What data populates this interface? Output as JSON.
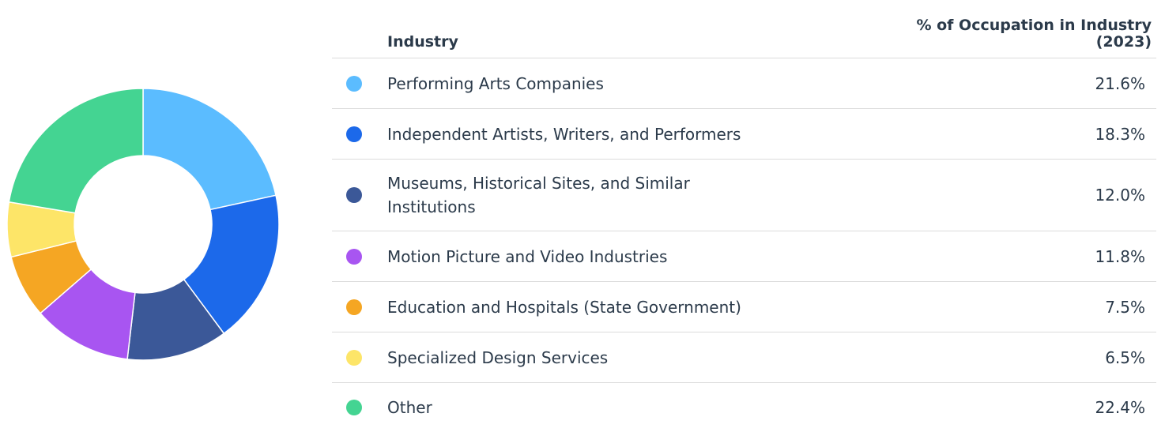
{
  "table": {
    "header_industry": "Industry",
    "header_pct_line1": "% of Occupation in Industry",
    "header_pct_line2": "(2023)"
  },
  "chart_data": {
    "type": "pie",
    "categories": [
      "Performing Arts Companies",
      "Independent Artists, Writers, and Performers",
      "Museums, Historical Sites, and Similar Institutions",
      "Motion Picture and Video Industries",
      "Education and Hospitals (State Government)",
      "Specialized Design Services",
      "Other"
    ],
    "values": [
      21.6,
      18.3,
      12.0,
      11.8,
      7.5,
      6.5,
      22.4
    ],
    "value_labels": [
      "21.6%",
      "18.3%",
      "12.0%",
      "11.8%",
      "7.5%",
      "6.5%",
      "22.4%"
    ],
    "colors": [
      "#5bbcff",
      "#1c69ea",
      "#3b5898",
      "#a855f1",
      "#f5a623",
      "#fde568",
      "#44d492"
    ],
    "donut": true,
    "legend": "right"
  }
}
